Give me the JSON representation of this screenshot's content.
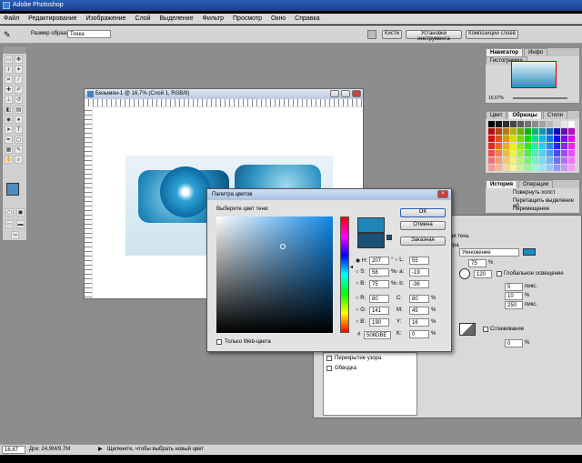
{
  "app": {
    "title": "Adobe Photoshop"
  },
  "menu": [
    "Файл",
    "Редактирование",
    "Изображение",
    "Слой",
    "Выделение",
    "Фильтр",
    "Просмотр",
    "Окно",
    "Справка"
  ],
  "options": {
    "sample_label": "Размер образца:",
    "sample_value": "Точка"
  },
  "tabs_top": [
    "Кисти",
    "Установки инструмента",
    "Композиции слоев"
  ],
  "doc": {
    "title": "Безымян-1 @ 16,7% (Слой 1, RGB/8)"
  },
  "picker": {
    "title": "Палитра цветов",
    "prompt": "Выберите цвет тени:",
    "ok": "OK",
    "cancel": "Отмена",
    "custom": "Заказная",
    "web_only": "Только Web-цвета",
    "H": "207",
    "S": "58",
    "B": "75",
    "R": "80",
    "G": "141",
    "Bl": "190",
    "L": "55",
    "a": "-19",
    "b": "-36",
    "C": "80",
    "M": "45",
    "Y": "16",
    "K": "0",
    "deg": "°",
    "pct": "%",
    "hex_label": "#",
    "hex": "508DBE"
  },
  "navigator": {
    "tabs": [
      "Навигатор",
      "Инфо",
      "Гистограмма"
    ],
    "zoom": "16,67%"
  },
  "swatches": {
    "tabs": [
      "Цвет",
      "Образцы",
      "Стили"
    ]
  },
  "history": {
    "tabs": [
      "История",
      "Операции"
    ],
    "items": [
      "Повернуть холст",
      "Перетащить выделение об",
      "Перемещение"
    ]
  },
  "layerstyle": {
    "title": "ая тень",
    "sub": "ура",
    "blend": "Умножение",
    "angle": "120",
    "global": "Глобальное освещение",
    "v1": "75",
    "v2": "5",
    "v3": "10",
    "v4": "250",
    "v5": "0",
    "units": "пикс.",
    "pct": "%",
    "noise_pct": "%",
    "invert": "Сглаживание",
    "items": [
      "Перекрытие узора",
      "Обводка"
    ]
  },
  "status": {
    "zoom": "16,67 %",
    "doc": "Док: 24,9M/9,7M",
    "hint": "Щелкните, чтобы выбрать новый цвет"
  },
  "colors": {
    "picked": "#508DBE",
    "chrome": "#d4d4d4",
    "workspace": "#8d8d8d"
  }
}
